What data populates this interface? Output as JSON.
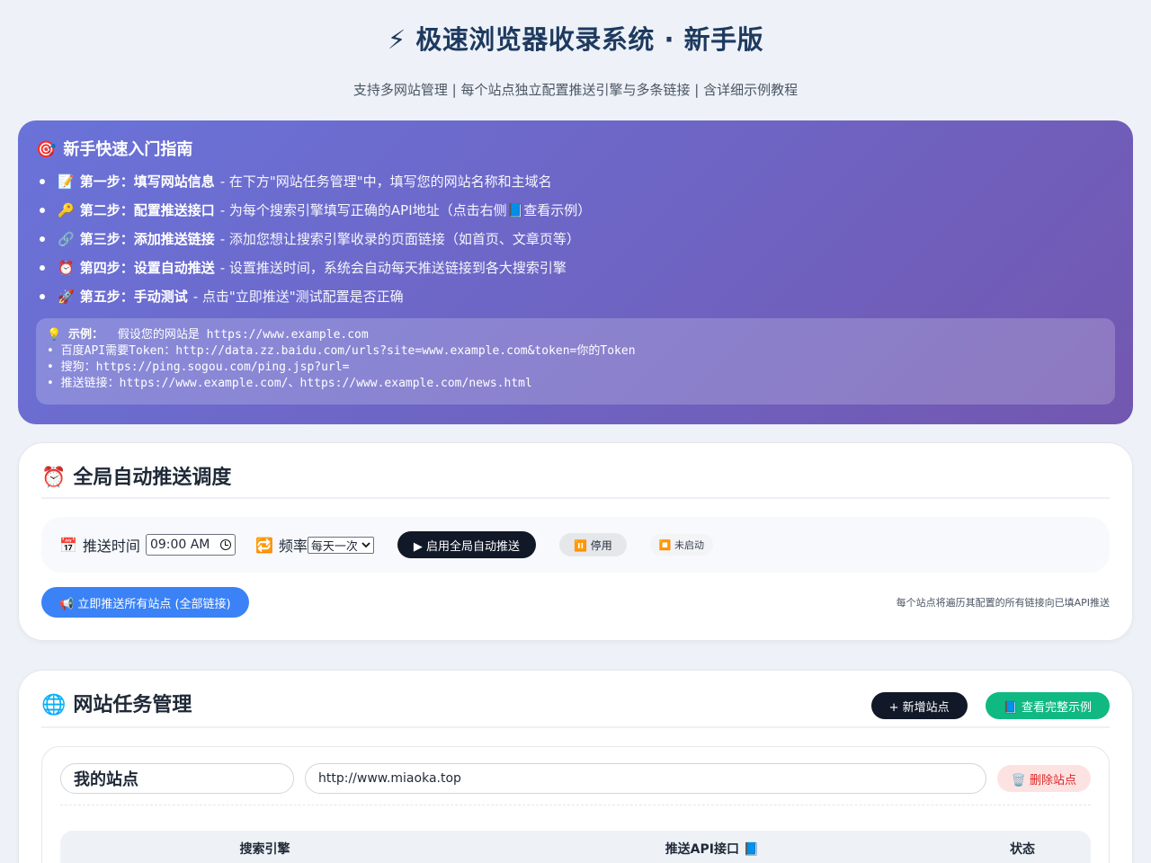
{
  "header": {
    "title": "⚡ 极速浏览器收录系统 · 新手版",
    "subtitle": "支持多网站管理 | 每个站点独立配置推送引擎与多条链接 | 含详细示例教程"
  },
  "guide": {
    "icon": "🎯",
    "title": "新手快速入门指南",
    "steps": [
      {
        "emoji": "📝",
        "label": "第一步：填写网站信息",
        "desc": "- 在下方\"网站任务管理\"中，填写您的网站名称和主域名"
      },
      {
        "emoji": "🔑",
        "label": "第二步：配置推送接口",
        "desc": "- 为每个搜索引擎填写正确的API地址（点击右侧📘查看示例）"
      },
      {
        "emoji": "🔗",
        "label": "第三步：添加推送链接",
        "desc": "- 添加您想让搜索引擎收录的页面链接（如首页、文章页等）"
      },
      {
        "emoji": "⏰",
        "label": "第四步：设置自动推送",
        "desc": "- 设置推送时间，系统会自动每天推送链接到各大搜索引擎"
      },
      {
        "emoji": "🚀",
        "label": "第五步：手动测试",
        "desc": "- 点击\"立即推送\"测试配置是否正确"
      }
    ],
    "example": {
      "icon": "💡",
      "label": "示例：",
      "intro": "假设您的网站是 https://www.example.com",
      "lines": [
        "• 百度API需要Token：http://data.zz.baidu.com/urls?site=www.example.com&token=你的Token",
        "• 搜狗：https://ping.sogou.com/ping.jsp?url=",
        "• 推送链接：https://www.example.com/、https://www.example.com/news.html"
      ]
    }
  },
  "schedule": {
    "icon": "⏰",
    "title": "全局自动推送调度",
    "time_icon": "📅",
    "time_label": "推送时间",
    "time_value": "09:00 AM",
    "freq_icon": "🔁",
    "freq_label": "频率",
    "freq_value": "每天一次",
    "enable_button": "▶ 启用全局自动推送",
    "stop_button": "⏸️ 停用",
    "status_chip": "⏹️ 未启动",
    "push_all_button": "📢 立即推送所有站点 (全部链接)",
    "note": "每个站点将遍历其配置的所有链接向已填API推送"
  },
  "sites": {
    "icon": "🌐",
    "title": "网站任务管理",
    "add_button": "+ 新增站点",
    "example_button": "📘 查看完整示例",
    "site": {
      "name": "我的站点",
      "url": "http://www.miaoka.top",
      "delete_button": "🗑️ 删除站点"
    },
    "table_headers": [
      "搜索引擎",
      "推送API接口 📘",
      "状态"
    ]
  }
}
